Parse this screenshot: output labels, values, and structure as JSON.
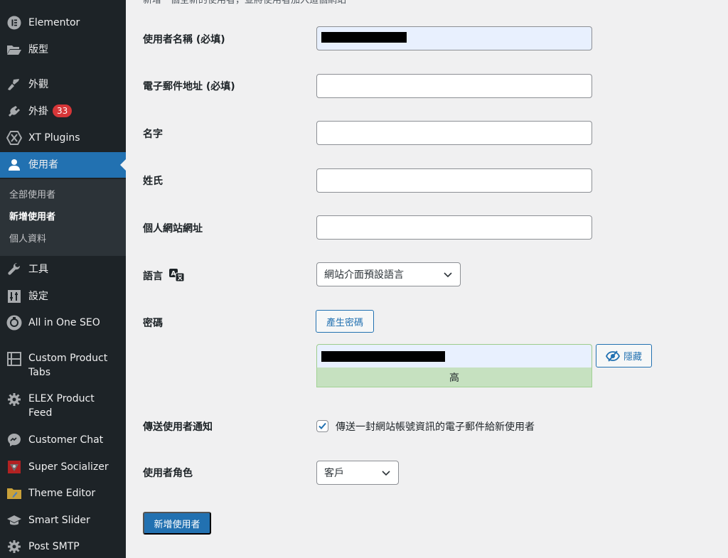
{
  "sidebar": {
    "items": [
      {
        "label": "Elementor",
        "icon": "elementor-icon"
      },
      {
        "label": "版型",
        "icon": "folder-icon"
      },
      {
        "label": "外觀",
        "icon": "paintbrush-icon"
      },
      {
        "label": "外掛",
        "icon": "plugin-icon",
        "badge": "33"
      },
      {
        "label": "XT Plugins",
        "icon": "xt-plugins-icon"
      },
      {
        "label": "使用者",
        "icon": "user-icon",
        "active": true
      },
      {
        "label": "工具",
        "icon": "wrench-icon"
      },
      {
        "label": "設定",
        "icon": "settings-sliders-icon"
      },
      {
        "label": "All in One SEO",
        "icon": "aioseo-icon"
      },
      {
        "label": "Custom Product Tabs",
        "icon": "tabs-icon"
      },
      {
        "label": "ELEX Product Feed",
        "icon": "gear-icon"
      },
      {
        "label": "Customer Chat",
        "icon": "messenger-icon"
      },
      {
        "label": "Super Socializer",
        "icon": "super-socializer-icon"
      },
      {
        "label": "Theme Editor",
        "icon": "theme-editor-folder-icon"
      },
      {
        "label": "Smart Slider",
        "icon": "graduation-cap-icon"
      },
      {
        "label": "Post SMTP",
        "icon": "gear-icon"
      }
    ],
    "submenu": [
      {
        "label": "全部使用者"
      },
      {
        "label": "新增使用者",
        "current": true
      },
      {
        "label": "個人資料"
      }
    ]
  },
  "form": {
    "intro": "新增一個全新的使用者，並將使用者加入這個網站",
    "username_label": "使用者名稱 (必填)",
    "email_label": "電子郵件地址 (必填)",
    "first_name_label": "名字",
    "last_name_label": "姓氏",
    "website_label": "個人網站網址",
    "language_label": "語言",
    "language_value": "網站介面預設語言",
    "password_label": "密碼",
    "generate_password_button": "產生密碼",
    "hide_button": "隱藏",
    "password_strength": "高",
    "notify_label": "傳送使用者通知",
    "notify_checked": true,
    "notify_text": "傳送一封網站帳號資訊的電子郵件給新使用者",
    "role_label": "使用者角色",
    "role_value": "客戶",
    "submit_button": "新增使用者"
  },
  "colors": {
    "sidebar_bg": "#1d2327",
    "accent": "#2271b1",
    "badge": "#d63638",
    "strength_strong": "#c6e1c0"
  }
}
